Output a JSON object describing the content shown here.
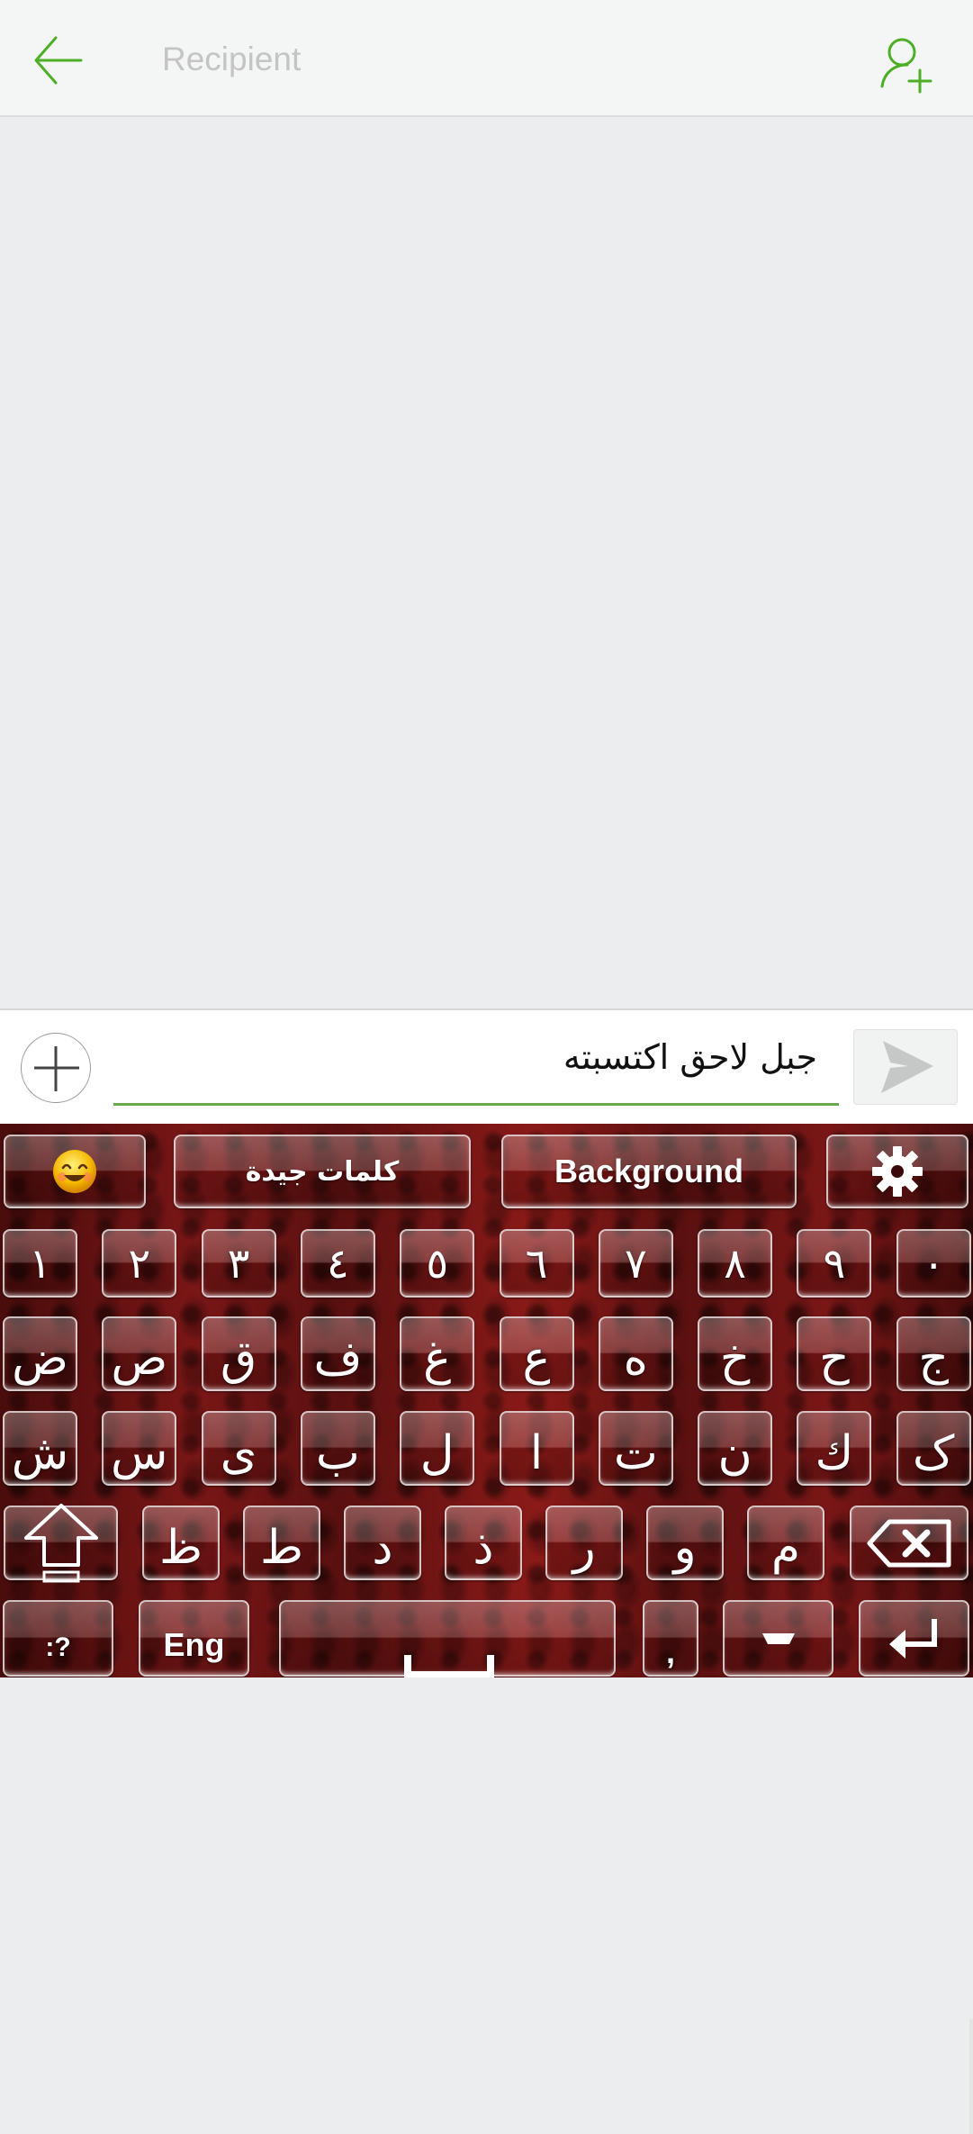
{
  "header": {
    "back_icon": "arrow-left-icon",
    "recipient_placeholder": "Recipient",
    "recipient_value": "",
    "add_contact_icon": "person-add-icon"
  },
  "compose": {
    "attach_icon": "plus-circle-icon",
    "message_text": "جبل لاحق اكتسبته",
    "send_icon": "send-arrow-icon"
  },
  "colors": {
    "accent_green": "#4caf25",
    "underline_green": "#6aa84f",
    "keyboard_red": "#7a1616"
  },
  "keyboard": {
    "toolbar": {
      "emoji_icon": "smiley-emoji-icon",
      "suggestions_label": "كلمات جيدة",
      "background_label": "Background",
      "settings_icon": "gear-icon"
    },
    "number_row": [
      "١",
      "٢",
      "٣",
      "٤",
      "٥",
      "٦",
      "٧",
      "٨",
      "٩",
      "٠"
    ],
    "row1": [
      "ض",
      "ص",
      "ق",
      "ف",
      "غ",
      "ع",
      "ه",
      "خ",
      "ح",
      "ج"
    ],
    "row2": [
      "ش",
      "س",
      "ى",
      "ب",
      "ل",
      "ا",
      "ت",
      "ن",
      "ك",
      "ک"
    ],
    "row3": [
      "ظ",
      "ط",
      "د",
      "ذ",
      "ر",
      "و",
      "م"
    ],
    "bottom": {
      "symbols_label": ":?",
      "lang_label": "Eng",
      "comma_label": ",",
      "tatweel_label": "ـ",
      "shift_icon": "shift-arrow-icon",
      "backspace_icon": "backspace-icon",
      "space_icon": "space-bar-icon",
      "enter_icon": "enter-return-icon"
    }
  }
}
